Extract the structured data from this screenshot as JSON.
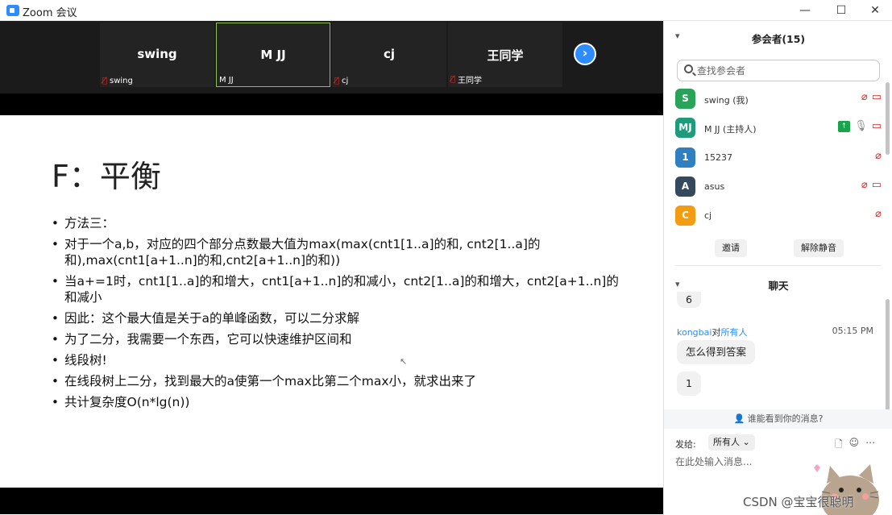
{
  "window": {
    "title": "Zoom 会议",
    "minimize": "—",
    "maximize": "☐",
    "close": "✕"
  },
  "strip": {
    "tiles": [
      {
        "name": "swing",
        "label": "swing",
        "muted": true
      },
      {
        "name": "M JJ",
        "label": "M JJ",
        "muted": false
      },
      {
        "name": "cj",
        "label": "cj",
        "muted": true
      },
      {
        "name": "王同学",
        "label": "王同学",
        "muted": true
      }
    ],
    "next_icon": "chevron-right"
  },
  "slide": {
    "title": "F：平衡",
    "bullets": [
      "方法三：",
      "对于一个a,b，对应的四个部分点数最大值为max(max(cnt1[1..a]的和, cnt2[1..a]的和),max(cnt1[a+1..n]的和,cnt2[a+1..n]的和))",
      "当a+=1时，cnt1[1..a]的和增大，cnt1[a+1..n]的和减小，cnt2[1..a]的和增大，cnt2[a+1..n]的和减小",
      "因此：这个最大值是关于a的单峰函数，可以二分求解",
      "为了二分，我需要一个东西，它可以快速维护区间和",
      "线段树!",
      "在线段树上二分，找到最大的a使第一个max比第二个max小，就求出来了",
      "共计复杂度O(n*lg(n))"
    ]
  },
  "participants_panel": {
    "title": "参会者(15)",
    "search_placeholder": "查找参会者",
    "participants": [
      {
        "initials": "S",
        "name": "swing (我)",
        "color": "#2aa35a",
        "mic": "muted",
        "video": "off",
        "share": false
      },
      {
        "initials": "MJ",
        "name": "M JJ (主持人)",
        "color": "#1f9a7a",
        "mic": "on",
        "video": "off",
        "share": true
      },
      {
        "initials": "1",
        "name": "15237",
        "color": "#2f7fc1",
        "mic": "muted",
        "video": "none",
        "share": false
      },
      {
        "initials": "A",
        "name": "asus",
        "color": "#34495e",
        "mic": "muted",
        "video": "off",
        "share": false
      },
      {
        "initials": "C",
        "name": "cj",
        "color": "#f39c12",
        "mic": "muted",
        "video": "none",
        "share": false
      }
    ],
    "invite_label": "邀请",
    "unmute_label": "解除静音"
  },
  "chat": {
    "title": "聊天",
    "partial_message": "6",
    "sender": "kongbai",
    "to_word": "对",
    "recipient": "所有人",
    "time": "05:15 PM",
    "messages": [
      "怎么得到答案",
      "1"
    ],
    "who_can_see": "谁能看到你的消息?",
    "send_to_label": "发给:",
    "send_to_value": "所有人",
    "input_placeholder": "在此处输入消息..."
  },
  "watermark": "CSDN @宝宝很聪明"
}
